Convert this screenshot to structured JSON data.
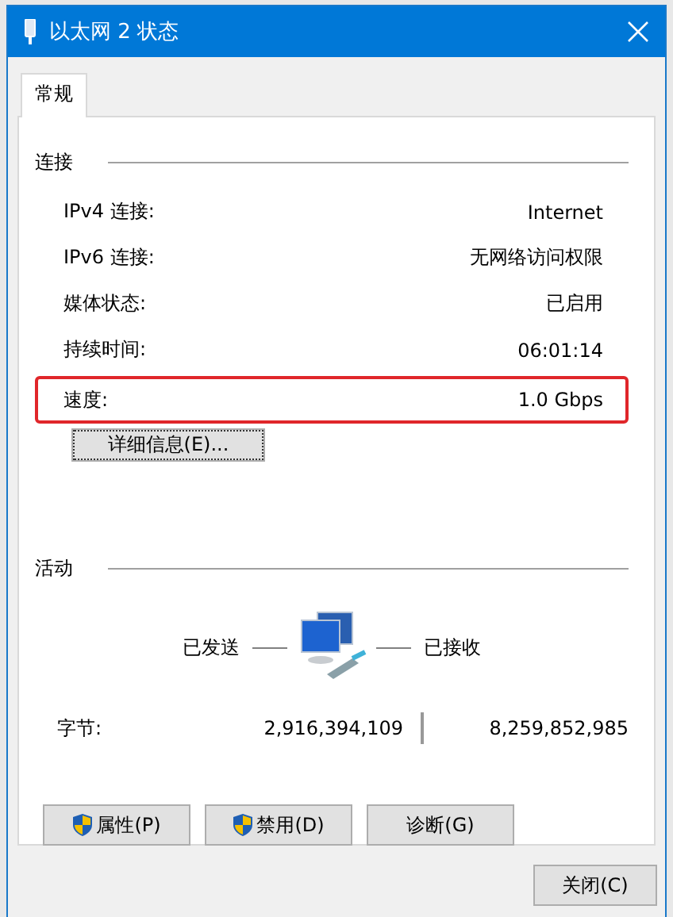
{
  "window": {
    "title": "以太网 2 状态"
  },
  "tabs": [
    {
      "label": "常规",
      "selected": true
    }
  ],
  "connection": {
    "heading": "连接",
    "rows": [
      {
        "label": "IPv4 连接:",
        "value": "Internet",
        "highlighted": false
      },
      {
        "label": "IPv6 连接:",
        "value": "无网络访问权限",
        "highlighted": false
      },
      {
        "label": "媒体状态:",
        "value": "已启用",
        "highlighted": false
      },
      {
        "label": "持续时间:",
        "value": "06:01:14",
        "highlighted": false
      },
      {
        "label": "速度:",
        "value": "1.0 Gbps",
        "highlighted": true
      }
    ],
    "details_button": "详细信息(E)..."
  },
  "activity": {
    "heading": "活动",
    "sent_label": "已发送",
    "received_label": "已接收",
    "bytes_label": "字节:",
    "bytes_sent": "2,916,394,109",
    "bytes_received": "8,259,852,985"
  },
  "buttons": [
    {
      "label": "属性(P)",
      "shield": true
    },
    {
      "label": "禁用(D)",
      "shield": true
    },
    {
      "label": "诊断(G)",
      "shield": false
    }
  ],
  "close_button": "关闭(C)"
}
